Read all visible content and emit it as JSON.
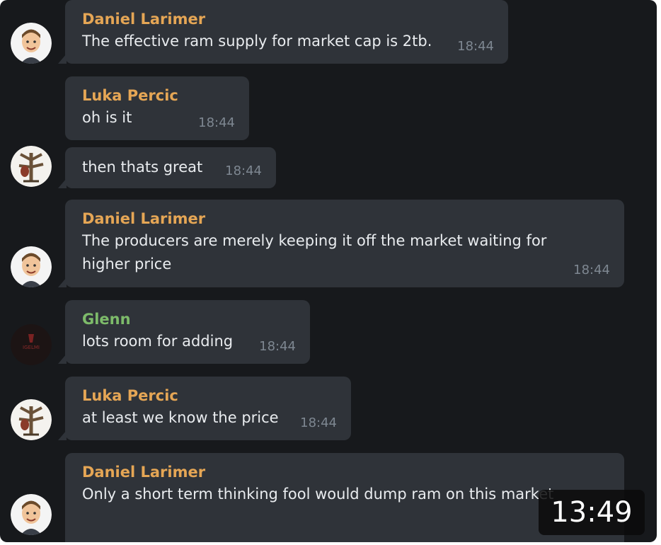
{
  "colors": {
    "background": "#17191c",
    "bubble": "#2f3339",
    "name_orange": "#e5a655",
    "name_green": "#7dbb6a",
    "timestamp": "#7e8791"
  },
  "messages": [
    {
      "sender": "Daniel Larimer",
      "text": "The effective ram supply for market cap is 2tb.",
      "time": "18:44"
    },
    {
      "sender": "Luka Percic",
      "text": "oh is it",
      "time": "18:44"
    },
    {
      "sender": "",
      "text": "then thats great",
      "time": "18:44"
    },
    {
      "sender": "Daniel Larimer",
      "text": "The producers are merely keeping it off the market waiting for",
      "text2": "higher price",
      "time": "18:44"
    },
    {
      "sender": "Glenn",
      "text": "lots room for adding",
      "time": "18:44"
    },
    {
      "sender": "Luka Percic",
      "text": "at least we know the price",
      "time": "18:44"
    },
    {
      "sender": "Daniel Larimer",
      "text": "Only a short term thinking fool would dump ram on this market",
      "time": ""
    }
  ],
  "avatar_glenn_text": "IGELMI",
  "video_timestamp": "13:49"
}
